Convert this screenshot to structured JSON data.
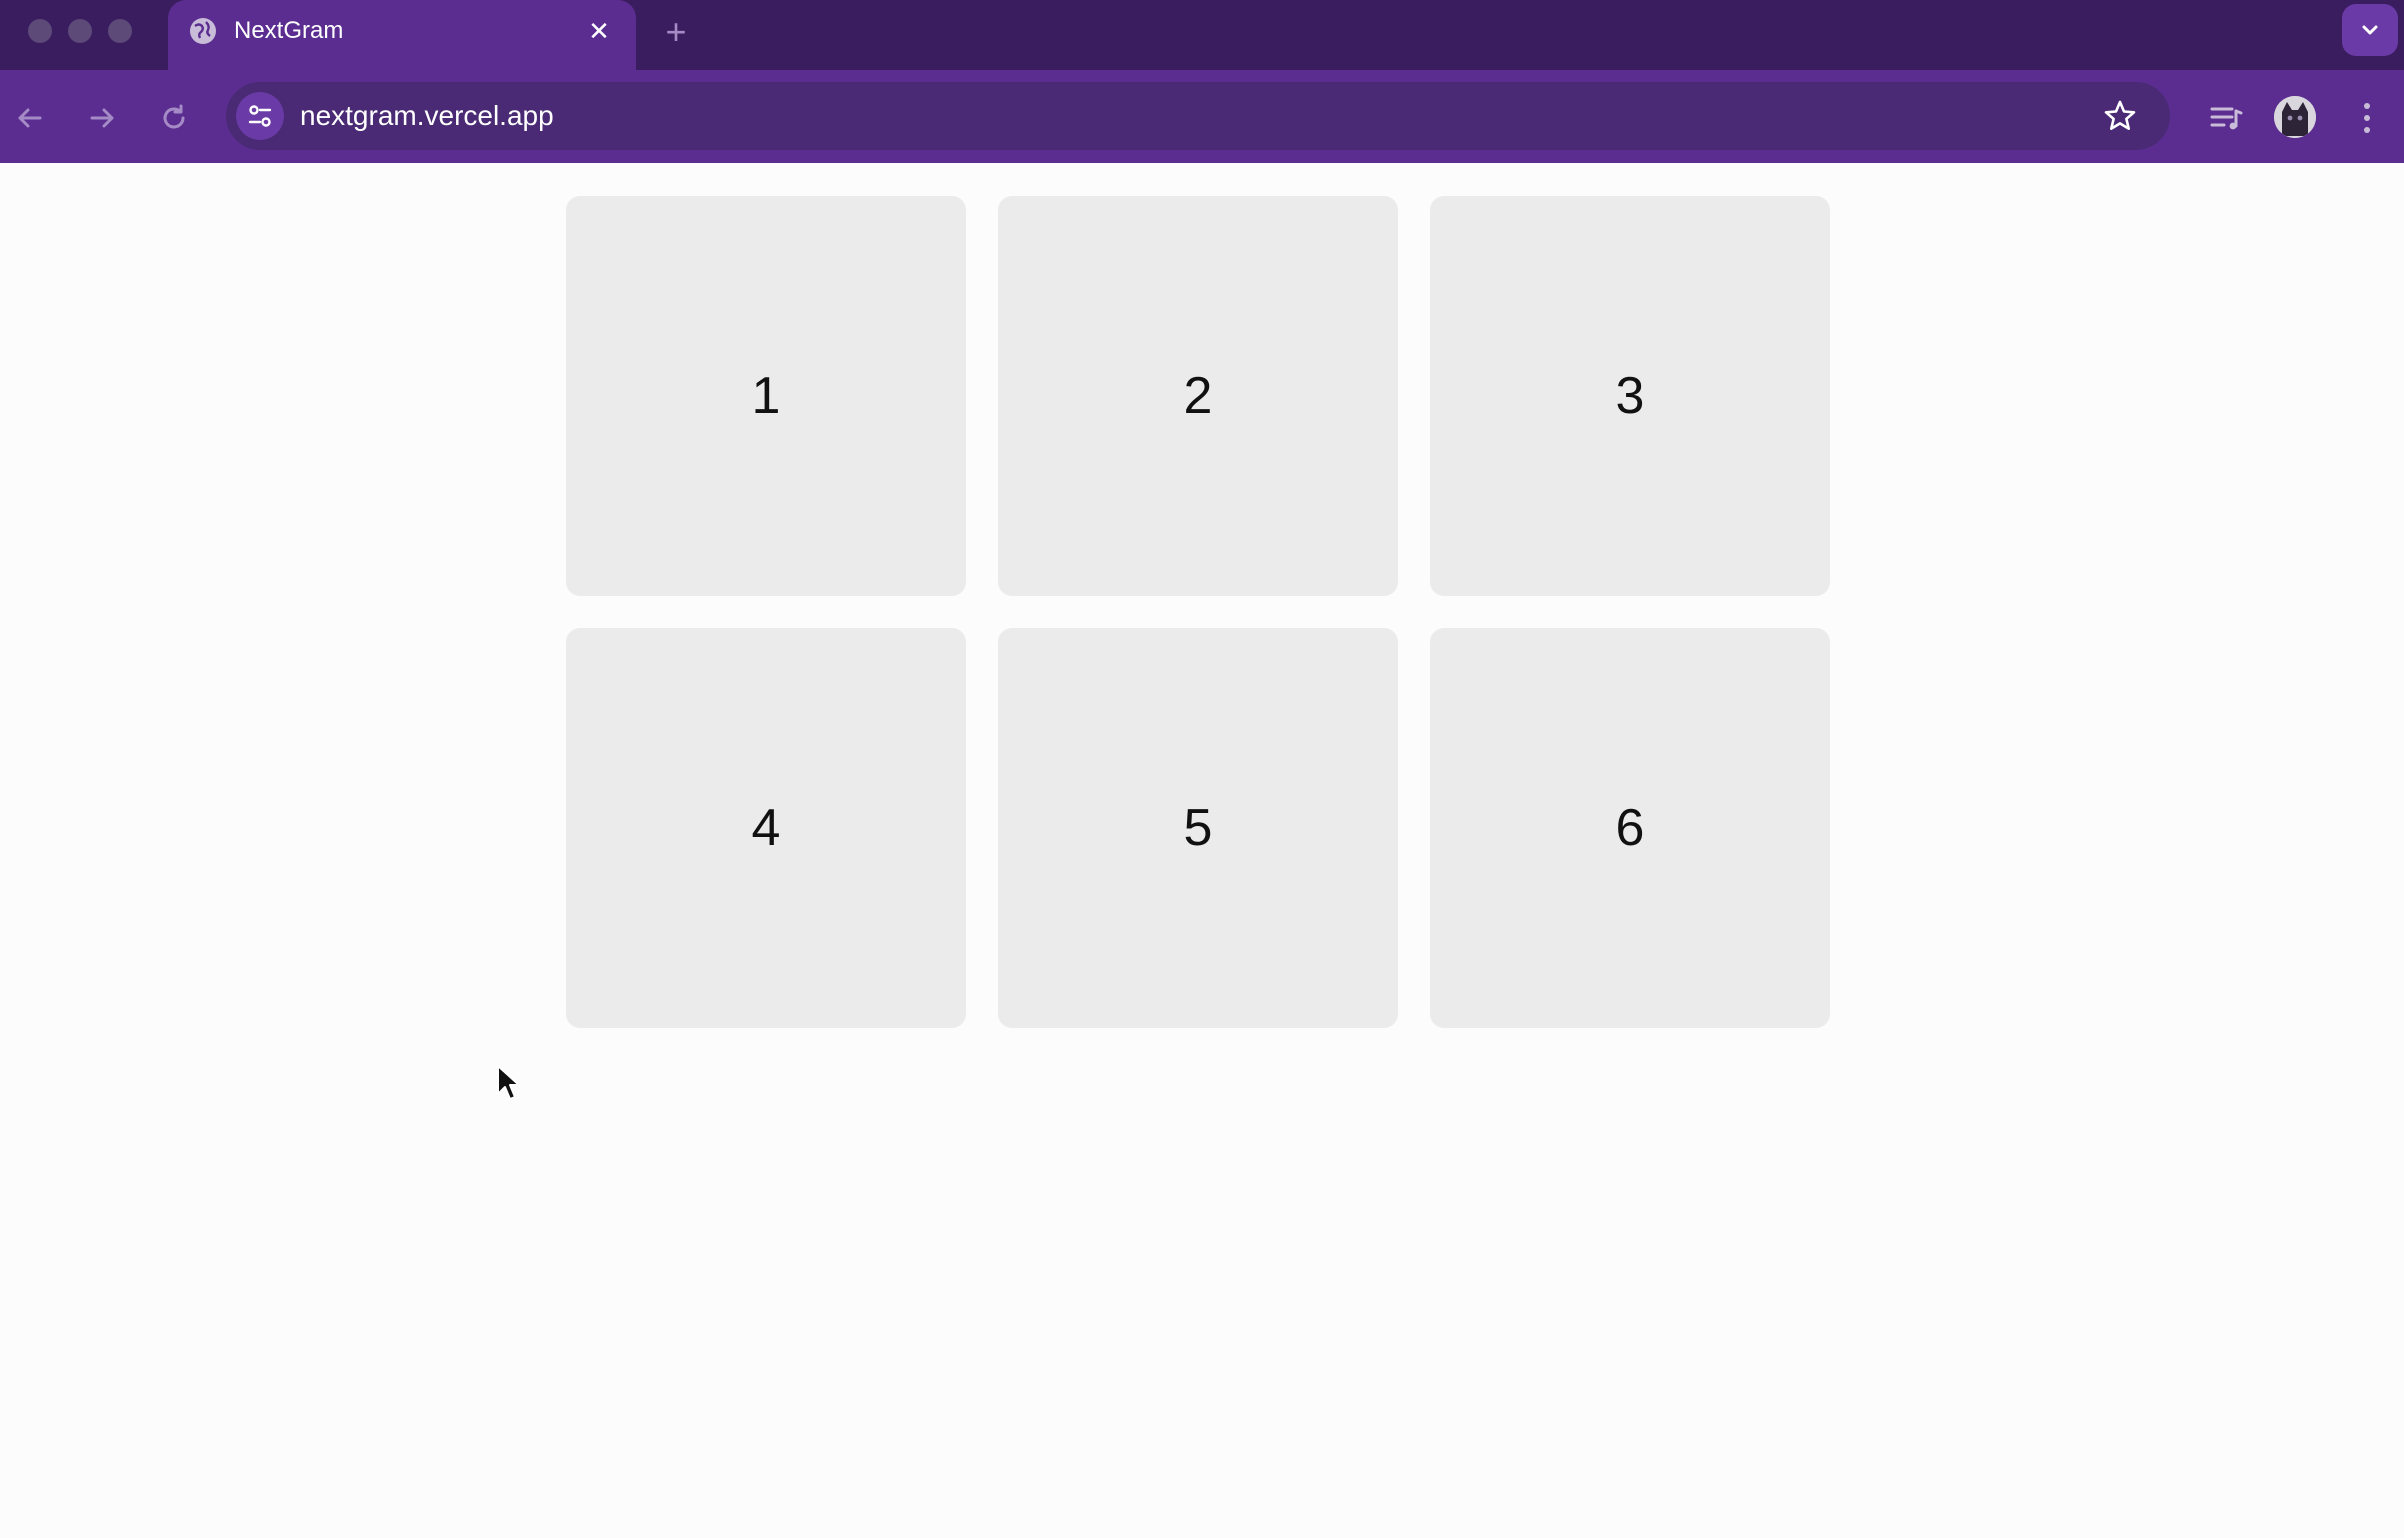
{
  "browser": {
    "tab": {
      "title": "NextGram",
      "close_glyph": "✕",
      "favicon": "globe-icon"
    },
    "new_tab_glyph": "+",
    "address_bar": {
      "url": "nextgram.vercel.app"
    },
    "icons": [
      "back-arrow-icon",
      "forward-arrow-icon",
      "reload-icon",
      "site-settings-icon",
      "bookmark-star-icon",
      "media-controls-icon",
      "profile-avatar",
      "kebab-menu-icon",
      "tab-search-chevron-icon"
    ],
    "colors": {
      "tabstrip": "#3a1d5e",
      "toolbar": "#5b2d91",
      "omnibox": "#4a2a74"
    }
  },
  "page": {
    "cards": [
      {
        "label": "1"
      },
      {
        "label": "2"
      },
      {
        "label": "3"
      },
      {
        "label": "4"
      },
      {
        "label": "5"
      },
      {
        "label": "6"
      }
    ],
    "colors": {
      "background": "#fcfcfc",
      "card": "#ebebeb"
    }
  }
}
